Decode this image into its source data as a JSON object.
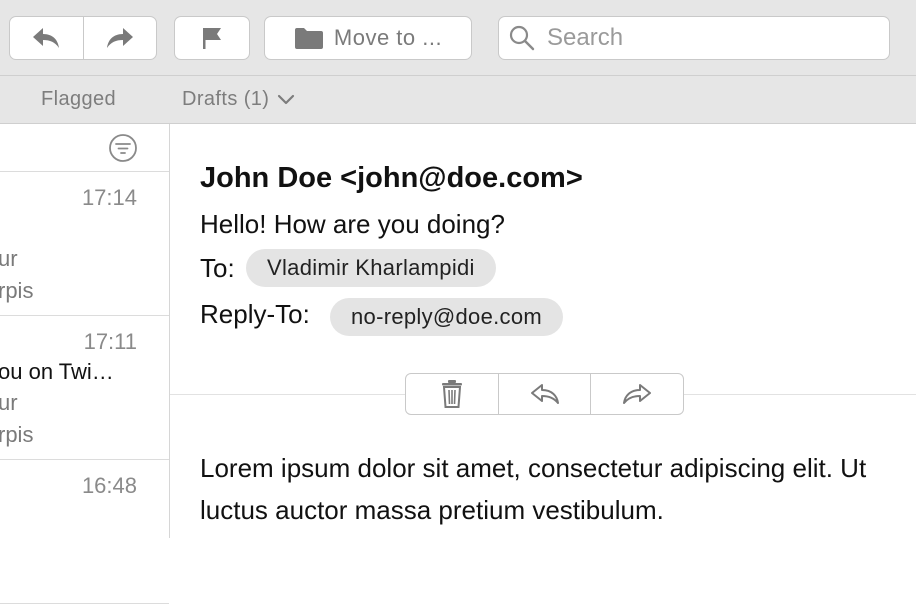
{
  "toolbar": {
    "move_label": "Move to ...",
    "search_placeholder": "Search"
  },
  "tabs": [
    {
      "label": "Flagged"
    },
    {
      "label": "Drafts (1)"
    }
  ],
  "messages": [
    {
      "time": "17:14",
      "line2": "ur",
      "line3": "rpis"
    },
    {
      "time": "17:11",
      "line1": "ou on Twi…",
      "line2": "ur",
      "line3": "rpis"
    },
    {
      "time": "16:48"
    }
  ],
  "message": {
    "from": "John Doe <john@doe.com>",
    "subject": "Hello! How are you doing?",
    "to_label": "To:",
    "to": "Vladimir Kharlampidi",
    "replyto_label": "Reply-To:",
    "replyto": "no-reply@doe.com",
    "body": "Lorem ipsum dolor sit amet, consectetur adipiscing elit. Ut luctus auctor massa pretium vestibulum."
  },
  "colors": {
    "toolbar_bg": "#e6e6e6",
    "icon_gray": "#7a7a7a",
    "pill_bg": "#e4e4e4"
  }
}
